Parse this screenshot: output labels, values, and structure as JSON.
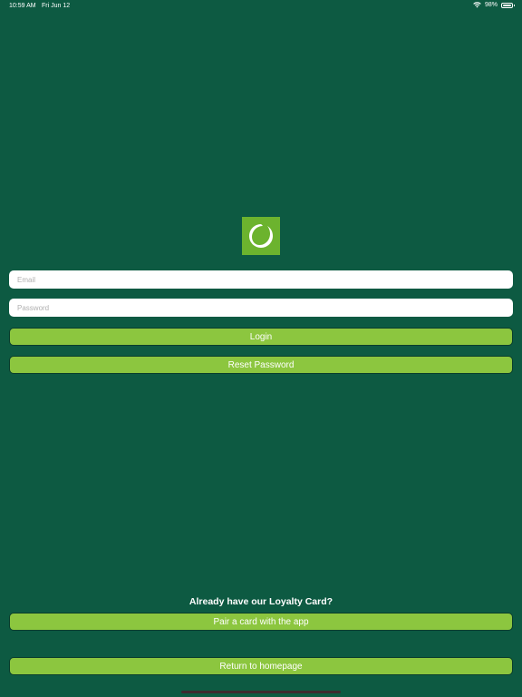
{
  "status_bar": {
    "time": "10:59 AM",
    "date": "Fri Jun 12",
    "battery_text": "98%",
    "battery_level": 0.98,
    "wifi_icon": "wifi-icon",
    "battery_icon": "battery-icon"
  },
  "logo": {
    "icon": "ring-logo-icon",
    "background": "#6cb32e"
  },
  "login_form": {
    "email_placeholder": "Email",
    "email_value": "",
    "password_placeholder": "Password",
    "password_value": "",
    "login_label": "Login",
    "reset_label": "Reset Password"
  },
  "loyalty": {
    "question": "Already have our Loyalty Card?",
    "pair_label": "Pair a card with the app"
  },
  "footer": {
    "home_label": "Return to homepage"
  },
  "colors": {
    "background": "#0d5a42",
    "button": "#8cc63f",
    "button_border": "#0a3d2c",
    "field": "#ffffff"
  }
}
